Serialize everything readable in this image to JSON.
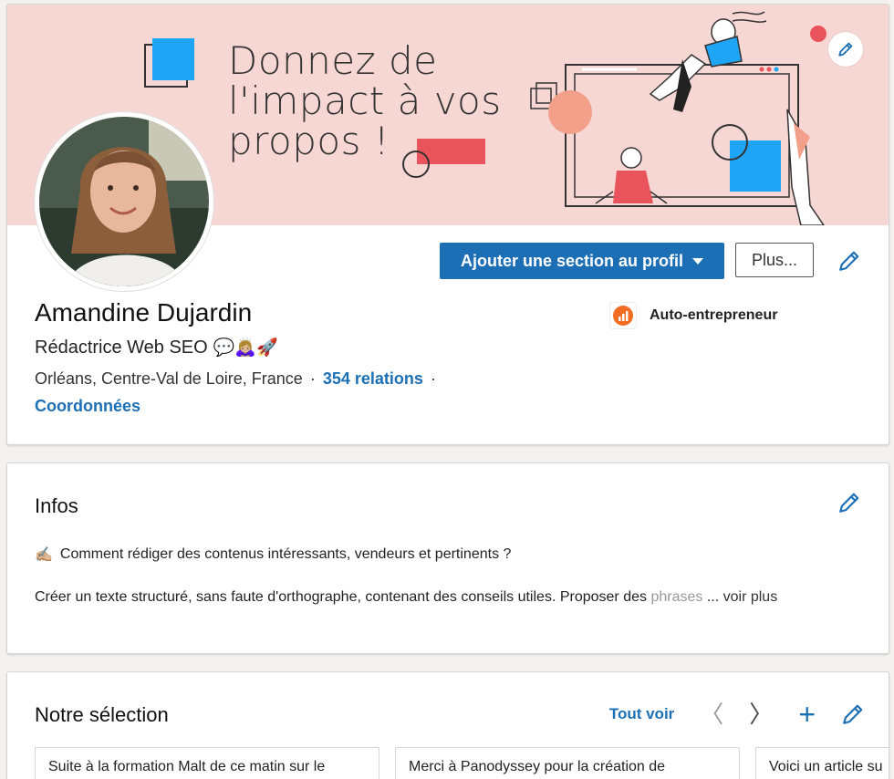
{
  "top_card": {
    "banner": {
      "line1": "Donnez de",
      "line2": "l'impact à vos",
      "line3": "propos !"
    },
    "actions": {
      "add_section_label": "Ajouter une section au profil",
      "more_label": "Plus..."
    },
    "name": "Amandine Dujardin",
    "headline": "Rédactrice Web SEO",
    "headline_emojis": "💬🙇🏼‍♀️🚀",
    "location": "Orléans, Centre-Val de Loire, France",
    "separator": "·",
    "connections": "354 relations",
    "contact_info": "Coordonnées",
    "company": "Auto-entrepreneur"
  },
  "infos": {
    "title": "Infos",
    "emoji": "✍🏼",
    "line1": "Comment rédiger des contenus intéressants, vendeurs et pertinents ?",
    "line2": "Créer un texte structuré, sans faute d'orthographe, contenant des conseils utiles. Proposer des",
    "line2_fade": "phrases",
    "ellipsis": "...",
    "see_more": "voir plus"
  },
  "selection": {
    "title": "Notre sélection",
    "see_all": "Tout voir",
    "prev": "〈",
    "next": "〉",
    "add": "+",
    "items": [
      "Suite à la formation Malt de ce matin sur le",
      "Merci à Panodyssey pour la création de",
      "Voici un article su"
    ]
  },
  "colors": {
    "accent": "#1d6fb5",
    "banner_bg": "#f7d7d4",
    "banner_red": "#e9535c",
    "banner_blue": "#1ea5f5"
  }
}
